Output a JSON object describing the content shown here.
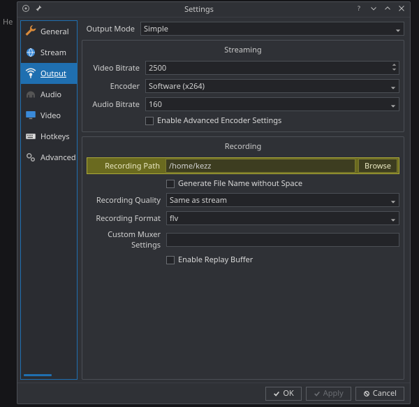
{
  "window": {
    "title": "Settings"
  },
  "sidebar": {
    "items": [
      {
        "label": "General"
      },
      {
        "label": "Stream"
      },
      {
        "label": "Output"
      },
      {
        "label": "Audio"
      },
      {
        "label": "Video"
      },
      {
        "label": "Hotkeys"
      },
      {
        "label": "Advanced"
      }
    ]
  },
  "output_mode": {
    "label": "Output Mode",
    "value": "Simple"
  },
  "streaming": {
    "title": "Streaming",
    "video_bitrate": {
      "label": "Video Bitrate",
      "value": "2500"
    },
    "encoder": {
      "label": "Encoder",
      "value": "Software (x264)"
    },
    "audio_bitrate": {
      "label": "Audio Bitrate",
      "value": "160"
    },
    "advanced_encoder": {
      "label": "Enable Advanced Encoder Settings"
    }
  },
  "recording": {
    "title": "Recording",
    "path": {
      "label": "Recording Path",
      "value": "/home/kezz",
      "browse": "Browse"
    },
    "no_space": {
      "label": "Generate File Name without Space"
    },
    "quality": {
      "label": "Recording Quality",
      "value": "Same as stream"
    },
    "format": {
      "label": "Recording Format",
      "value": "flv"
    },
    "muxer": {
      "label": "Custom Muxer Settings",
      "value": ""
    },
    "replay": {
      "label": "Enable Replay Buffer"
    }
  },
  "footer": {
    "ok": "OK",
    "apply": "Apply",
    "cancel": "Cancel"
  },
  "backdrop_text": "He"
}
